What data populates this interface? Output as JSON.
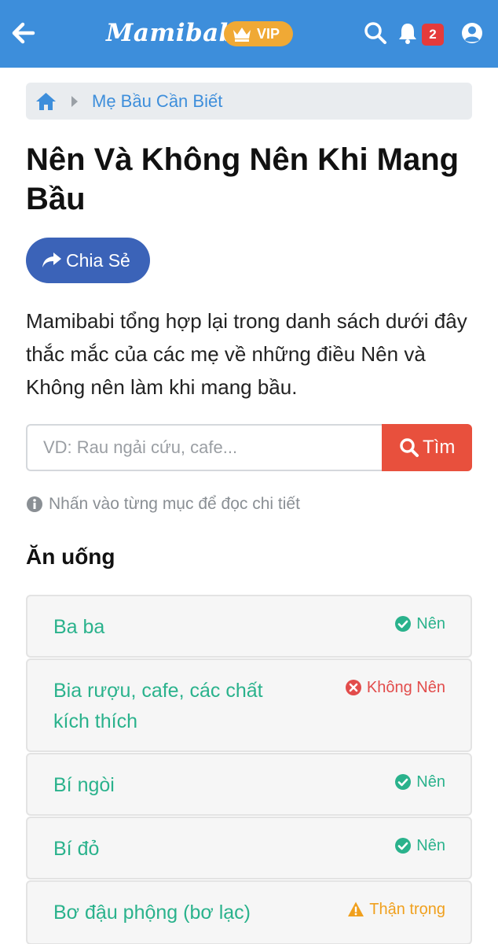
{
  "header": {
    "logo": "Mamibabi",
    "vip_label": "VIP",
    "notification_count": "2",
    "icons": [
      "back-arrow-icon",
      "crown-icon",
      "search-icon",
      "bell-icon",
      "user-icon"
    ],
    "colors": {
      "bar": "#3d8edb",
      "vip": "#f0a935",
      "badge": "#e53b3b"
    }
  },
  "breadcrumb": {
    "items": [
      "Mẹ Bầu Cần Biết"
    ]
  },
  "page": {
    "title": "Nên Và Không Nên Khi Mang Bầu",
    "share_label": "Chia Sẻ",
    "intro": "Mamibabi tổng hợp lại trong danh sách dưới đây thắc mắc của các mẹ về những điều Nên và Không nên làm khi mang bầu."
  },
  "search": {
    "placeholder": "VD: Rau ngải cứu, cafe...",
    "button_label": "Tìm"
  },
  "hint": "Nhấn vào từng mục để đọc chi tiết",
  "section": {
    "title": "Ăn uống",
    "items": [
      {
        "name": "Ba ba",
        "status": "Nên",
        "type": "ok"
      },
      {
        "name": "Bia rượu, cafe, các chất kích thích",
        "status": "Không Nên",
        "type": "no"
      },
      {
        "name": "Bí ngòi",
        "status": "Nên",
        "type": "ok"
      },
      {
        "name": "Bí đỏ",
        "status": "Nên",
        "type": "ok"
      },
      {
        "name": "Bơ đậu phộng (bơ lạc)",
        "status": "Thận trọng",
        "type": "warn"
      }
    ]
  },
  "status_colors": {
    "ok": "#2ab28c",
    "no": "#e24c4b",
    "warn": "#f0a01d"
  }
}
